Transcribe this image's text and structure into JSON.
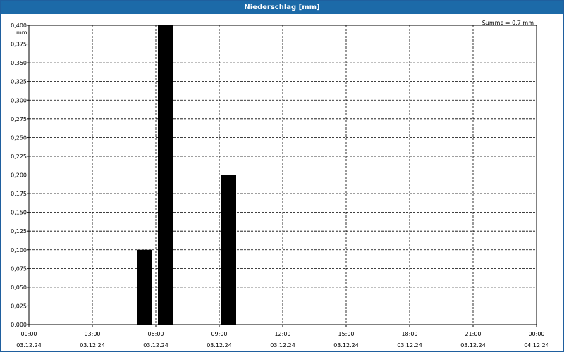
{
  "window": {
    "title": "Niederschlag [mm]"
  },
  "chart_data": {
    "type": "bar",
    "title": "Niederschlag [mm]",
    "ylabel": "mm",
    "annotation": "Summe = 0,7 mm",
    "ylim": [
      0,
      0.4
    ],
    "y_ticks": [
      "0,000",
      "0,025",
      "0,050",
      "0,075",
      "0,100",
      "0,125",
      "0,150",
      "0,175",
      "0,200",
      "0,225",
      "0,250",
      "0,275",
      "0,300",
      "0,325",
      "0,350",
      "0,375",
      "0,400"
    ],
    "x_range_hours": [
      0,
      24
    ],
    "x_ticks": [
      {
        "time": "00:00",
        "date": "03.12.24"
      },
      {
        "time": "03:00",
        "date": "03.12.24"
      },
      {
        "time": "06:00",
        "date": "03.12.24"
      },
      {
        "time": "09:00",
        "date": "03.12.24"
      },
      {
        "time": "12:00",
        "date": "03.12.24"
      },
      {
        "time": "15:00",
        "date": "03.12.24"
      },
      {
        "time": "18:00",
        "date": "03.12.24"
      },
      {
        "time": "21:00",
        "date": "03.12.24"
      },
      {
        "time": "00:00",
        "date": "04.12.24"
      }
    ],
    "bars": [
      {
        "start": "05:00",
        "end": "06:00",
        "value": 0.1
      },
      {
        "start": "06:00",
        "end": "07:00",
        "value": 0.4
      },
      {
        "start": "09:00",
        "end": "10:00",
        "value": 0.2
      }
    ],
    "grid": true,
    "bar_color": "#000000"
  }
}
